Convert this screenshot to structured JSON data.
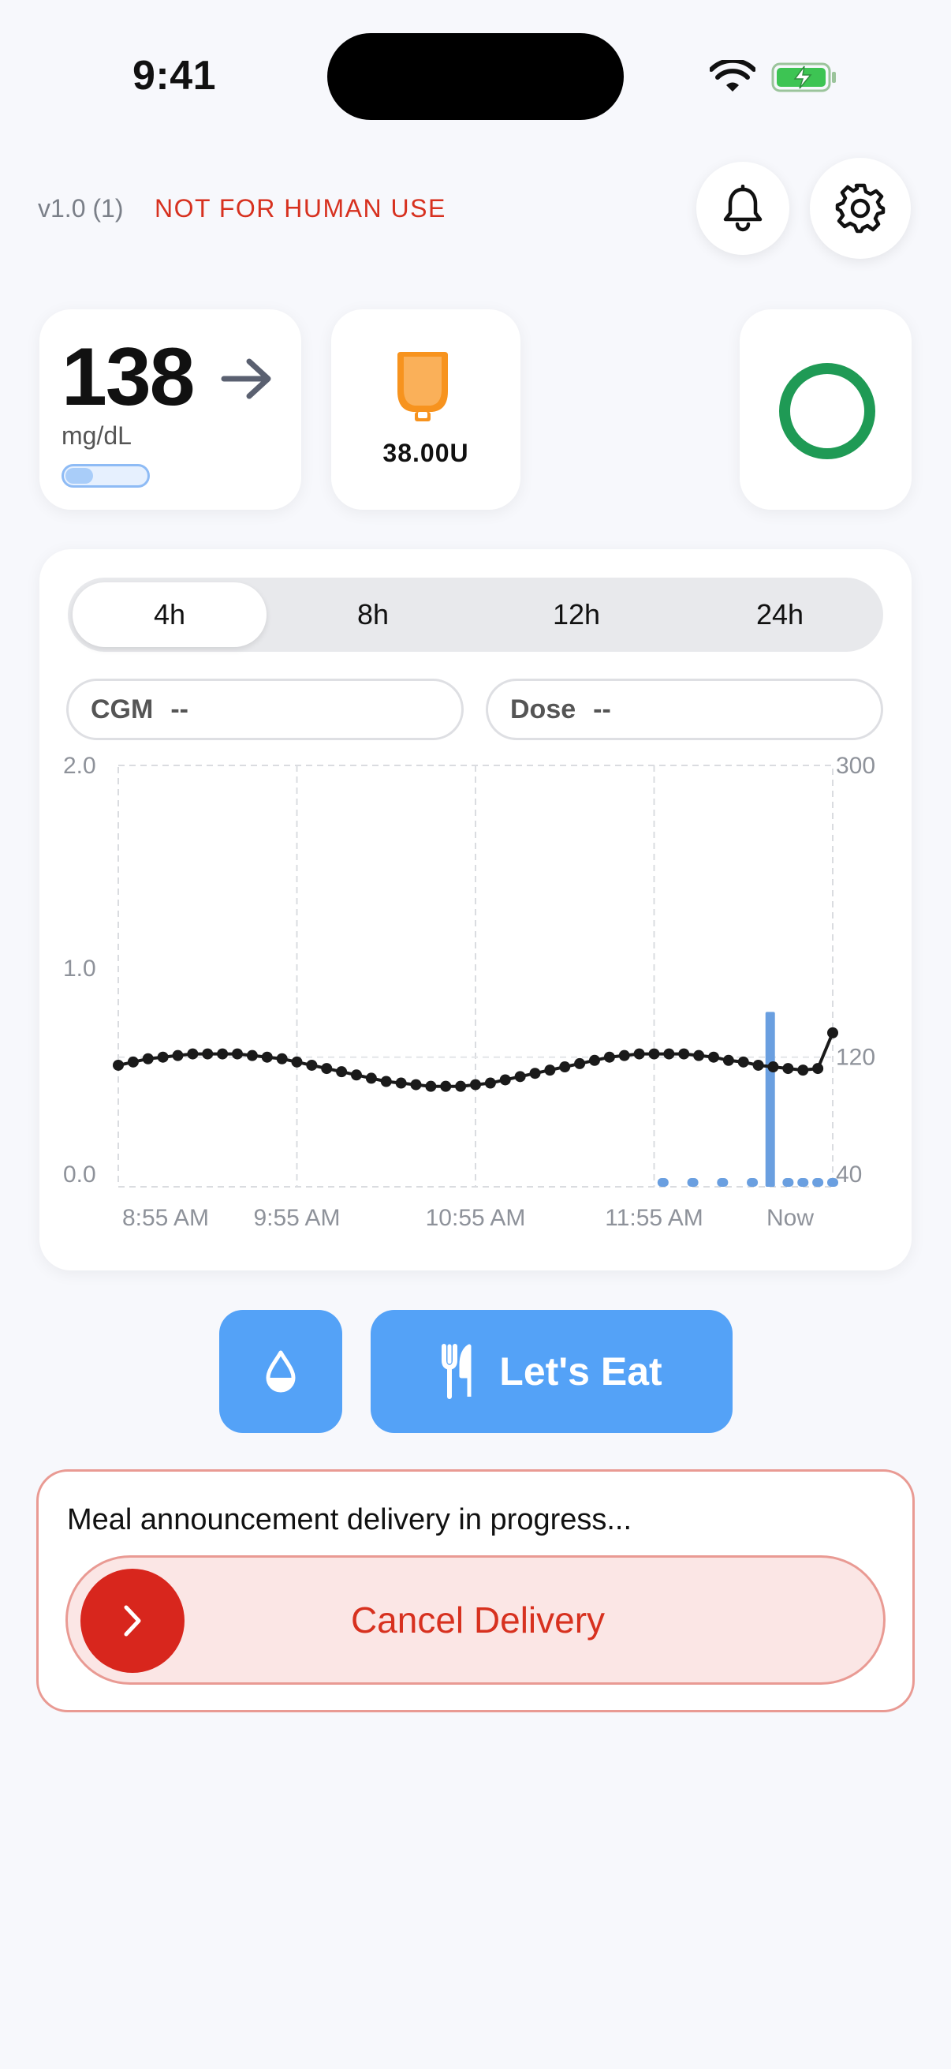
{
  "status_bar": {
    "time": "9:41"
  },
  "header": {
    "version": "v1.0 (1)",
    "warning": "NOT FOR HUMAN USE"
  },
  "glucose": {
    "value": "138",
    "unit": "mg/dL",
    "trend_icon": "arrow-right-icon",
    "level_fraction": 0.35
  },
  "pump": {
    "reservoir": "38.00U",
    "icon": "insulin-reservoir-icon",
    "accent": "#F7931E"
  },
  "loop_status": {
    "icon": "loop-ring-icon",
    "color": "#1F9A55"
  },
  "chart": {
    "ranges": [
      {
        "label": "4h",
        "active": true
      },
      {
        "label": "8h",
        "active": false
      },
      {
        "label": "12h",
        "active": false
      },
      {
        "label": "24h",
        "active": false
      }
    ],
    "cgm_label": "CGM",
    "cgm_value": "--",
    "dose_label": "Dose",
    "dose_value": "--"
  },
  "chart_data": {
    "type": "line",
    "left_axis": {
      "ticks": [
        "2.0",
        "1.0",
        "0.0"
      ],
      "range": [
        0,
        2
      ]
    },
    "right_axis": {
      "ticks": [
        "300",
        "120",
        "40"
      ],
      "range": [
        40,
        300
      ]
    },
    "x_ticks": [
      "8:55 AM",
      "9:55 AM",
      "10:55 AM",
      "11:55 AM",
      "Now"
    ],
    "x_range_minutes": [
      0,
      240
    ],
    "series": [
      {
        "axis": "right",
        "x_minutes": [
          0,
          5,
          10,
          15,
          20,
          25,
          30,
          35,
          40,
          45,
          50,
          55,
          60,
          65,
          70,
          75,
          80,
          85,
          90,
          95,
          100,
          105,
          110,
          115,
          120,
          125,
          130,
          135,
          140,
          145,
          150,
          155,
          160,
          165,
          170,
          175,
          180,
          185,
          190,
          195,
          200,
          205,
          210,
          215,
          220,
          225,
          230,
          235,
          240
        ],
        "values": [
          115,
          117,
          119,
          120,
          121,
          122,
          122,
          122,
          122,
          121,
          120,
          119,
          117,
          115,
          113,
          111,
          109,
          107,
          105,
          104,
          103,
          102,
          102,
          102,
          103,
          104,
          106,
          108,
          110,
          112,
          114,
          116,
          118,
          120,
          121,
          122,
          122,
          122,
          122,
          121,
          120,
          118,
          117,
          115,
          114,
          113,
          112,
          113,
          135
        ]
      },
      {
        "axis": "left",
        "type": "bar",
        "x_minutes": [
          183,
          193,
          203,
          213,
          219,
          225,
          230,
          235,
          240
        ],
        "values": [
          0.03,
          0.03,
          0.02,
          0.02,
          0.83,
          0.03,
          0.02,
          0.03,
          0.03
        ]
      }
    ],
    "colors": {
      "cgm": "#1A1A1A",
      "dose": "#6A9FE0"
    }
  },
  "actions": {
    "eat_label": "Let's Eat",
    "drop_icon": "water-drop-icon"
  },
  "delivery": {
    "message": "Meal announcement delivery in progress...",
    "cancel_label": "Cancel Delivery",
    "accent": "#D8261D"
  }
}
